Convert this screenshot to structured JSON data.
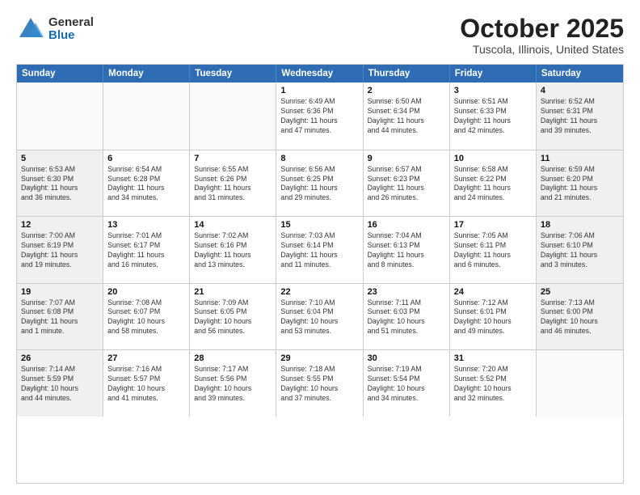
{
  "logo": {
    "general": "General",
    "blue": "Blue"
  },
  "title": "October 2025",
  "location": "Tuscola, Illinois, United States",
  "header_days": [
    "Sunday",
    "Monday",
    "Tuesday",
    "Wednesday",
    "Thursday",
    "Friday",
    "Saturday"
  ],
  "weeks": [
    [
      {
        "day": "",
        "text": "",
        "empty": true
      },
      {
        "day": "",
        "text": "",
        "empty": true
      },
      {
        "day": "",
        "text": "",
        "empty": true
      },
      {
        "day": "1",
        "text": "Sunrise: 6:49 AM\nSunset: 6:36 PM\nDaylight: 11 hours\nand 47 minutes."
      },
      {
        "day": "2",
        "text": "Sunrise: 6:50 AM\nSunset: 6:34 PM\nDaylight: 11 hours\nand 44 minutes."
      },
      {
        "day": "3",
        "text": "Sunrise: 6:51 AM\nSunset: 6:33 PM\nDaylight: 11 hours\nand 42 minutes."
      },
      {
        "day": "4",
        "text": "Sunrise: 6:52 AM\nSunset: 6:31 PM\nDaylight: 11 hours\nand 39 minutes."
      }
    ],
    [
      {
        "day": "5",
        "text": "Sunrise: 6:53 AM\nSunset: 6:30 PM\nDaylight: 11 hours\nand 36 minutes."
      },
      {
        "day": "6",
        "text": "Sunrise: 6:54 AM\nSunset: 6:28 PM\nDaylight: 11 hours\nand 34 minutes."
      },
      {
        "day": "7",
        "text": "Sunrise: 6:55 AM\nSunset: 6:26 PM\nDaylight: 11 hours\nand 31 minutes."
      },
      {
        "day": "8",
        "text": "Sunrise: 6:56 AM\nSunset: 6:25 PM\nDaylight: 11 hours\nand 29 minutes."
      },
      {
        "day": "9",
        "text": "Sunrise: 6:57 AM\nSunset: 6:23 PM\nDaylight: 11 hours\nand 26 minutes."
      },
      {
        "day": "10",
        "text": "Sunrise: 6:58 AM\nSunset: 6:22 PM\nDaylight: 11 hours\nand 24 minutes."
      },
      {
        "day": "11",
        "text": "Sunrise: 6:59 AM\nSunset: 6:20 PM\nDaylight: 11 hours\nand 21 minutes."
      }
    ],
    [
      {
        "day": "12",
        "text": "Sunrise: 7:00 AM\nSunset: 6:19 PM\nDaylight: 11 hours\nand 19 minutes."
      },
      {
        "day": "13",
        "text": "Sunrise: 7:01 AM\nSunset: 6:17 PM\nDaylight: 11 hours\nand 16 minutes."
      },
      {
        "day": "14",
        "text": "Sunrise: 7:02 AM\nSunset: 6:16 PM\nDaylight: 11 hours\nand 13 minutes."
      },
      {
        "day": "15",
        "text": "Sunrise: 7:03 AM\nSunset: 6:14 PM\nDaylight: 11 hours\nand 11 minutes."
      },
      {
        "day": "16",
        "text": "Sunrise: 7:04 AM\nSunset: 6:13 PM\nDaylight: 11 hours\nand 8 minutes."
      },
      {
        "day": "17",
        "text": "Sunrise: 7:05 AM\nSunset: 6:11 PM\nDaylight: 11 hours\nand 6 minutes."
      },
      {
        "day": "18",
        "text": "Sunrise: 7:06 AM\nSunset: 6:10 PM\nDaylight: 11 hours\nand 3 minutes."
      }
    ],
    [
      {
        "day": "19",
        "text": "Sunrise: 7:07 AM\nSunset: 6:08 PM\nDaylight: 11 hours\nand 1 minute."
      },
      {
        "day": "20",
        "text": "Sunrise: 7:08 AM\nSunset: 6:07 PM\nDaylight: 10 hours\nand 58 minutes."
      },
      {
        "day": "21",
        "text": "Sunrise: 7:09 AM\nSunset: 6:05 PM\nDaylight: 10 hours\nand 56 minutes."
      },
      {
        "day": "22",
        "text": "Sunrise: 7:10 AM\nSunset: 6:04 PM\nDaylight: 10 hours\nand 53 minutes."
      },
      {
        "day": "23",
        "text": "Sunrise: 7:11 AM\nSunset: 6:03 PM\nDaylight: 10 hours\nand 51 minutes."
      },
      {
        "day": "24",
        "text": "Sunrise: 7:12 AM\nSunset: 6:01 PM\nDaylight: 10 hours\nand 49 minutes."
      },
      {
        "day": "25",
        "text": "Sunrise: 7:13 AM\nSunset: 6:00 PM\nDaylight: 10 hours\nand 46 minutes."
      }
    ],
    [
      {
        "day": "26",
        "text": "Sunrise: 7:14 AM\nSunset: 5:59 PM\nDaylight: 10 hours\nand 44 minutes."
      },
      {
        "day": "27",
        "text": "Sunrise: 7:16 AM\nSunset: 5:57 PM\nDaylight: 10 hours\nand 41 minutes."
      },
      {
        "day": "28",
        "text": "Sunrise: 7:17 AM\nSunset: 5:56 PM\nDaylight: 10 hours\nand 39 minutes."
      },
      {
        "day": "29",
        "text": "Sunrise: 7:18 AM\nSunset: 5:55 PM\nDaylight: 10 hours\nand 37 minutes."
      },
      {
        "day": "30",
        "text": "Sunrise: 7:19 AM\nSunset: 5:54 PM\nDaylight: 10 hours\nand 34 minutes."
      },
      {
        "day": "31",
        "text": "Sunrise: 7:20 AM\nSunset: 5:52 PM\nDaylight: 10 hours\nand 32 minutes."
      },
      {
        "day": "",
        "text": "",
        "empty": true
      }
    ]
  ]
}
